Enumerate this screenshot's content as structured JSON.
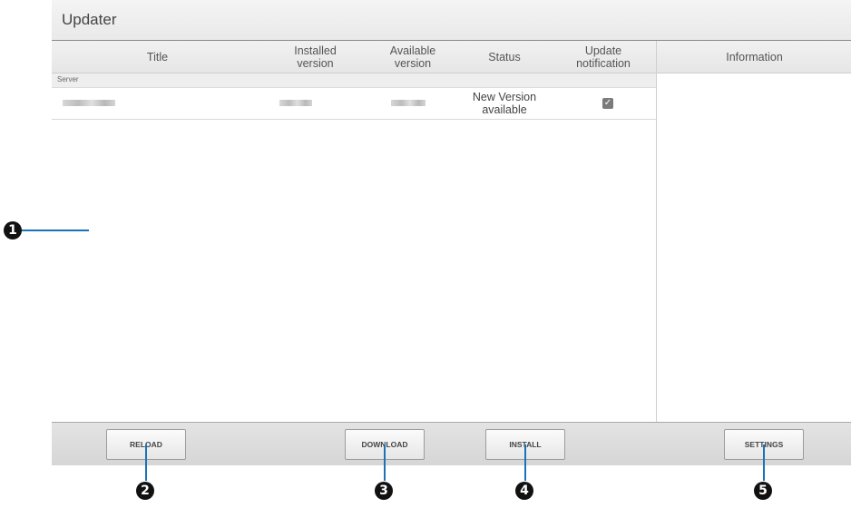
{
  "window": {
    "title": "Updater"
  },
  "table": {
    "columns": [
      "Title",
      "Installed\nversion",
      "Available\nversion",
      "Status",
      "Update\nnotification"
    ],
    "group_label": "Server",
    "rows": [
      {
        "status": "New Version\navailable",
        "notify_checked": true
      }
    ]
  },
  "info_panel": {
    "header": "Information"
  },
  "footer": {
    "reload": "RELOAD",
    "download": "DOWNLOAD",
    "install": "INSTALL",
    "settings": "SETTINGS"
  },
  "callouts": [
    "1",
    "2",
    "3",
    "4",
    "5"
  ],
  "colors": {
    "callout_line": "#1a73b8",
    "badge": "#111111"
  }
}
